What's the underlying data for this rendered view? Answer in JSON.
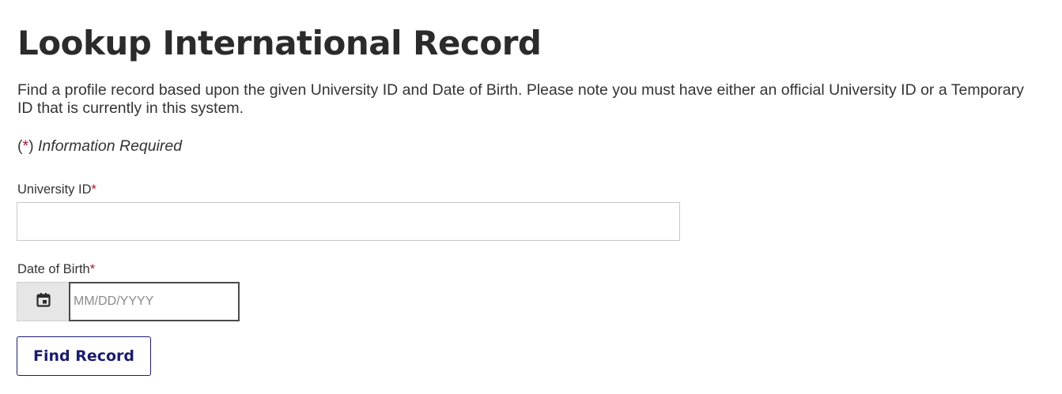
{
  "page": {
    "title": "Lookup International Record",
    "description": "Find a profile record based upon the given University ID and Date of Birth. Please note you must have either an official University ID or a Temporary ID that is currently in this system.",
    "required_note": {
      "open_paren": "(",
      "asterisk": "*",
      "close_paren": ")",
      "text": "Information Required"
    }
  },
  "form": {
    "university_id": {
      "label": "University ID",
      "required_marker": "*",
      "value": "",
      "placeholder": ""
    },
    "date_of_birth": {
      "label": "Date of Birth",
      "required_marker": "*",
      "value": "",
      "placeholder": "MM/DD/YYYY",
      "calendar_icon": "calendar-icon"
    },
    "submit_label": "Find Record"
  },
  "colors": {
    "required": "#a6192e",
    "button_accent": "#1c1c6b",
    "text": "#333333"
  }
}
